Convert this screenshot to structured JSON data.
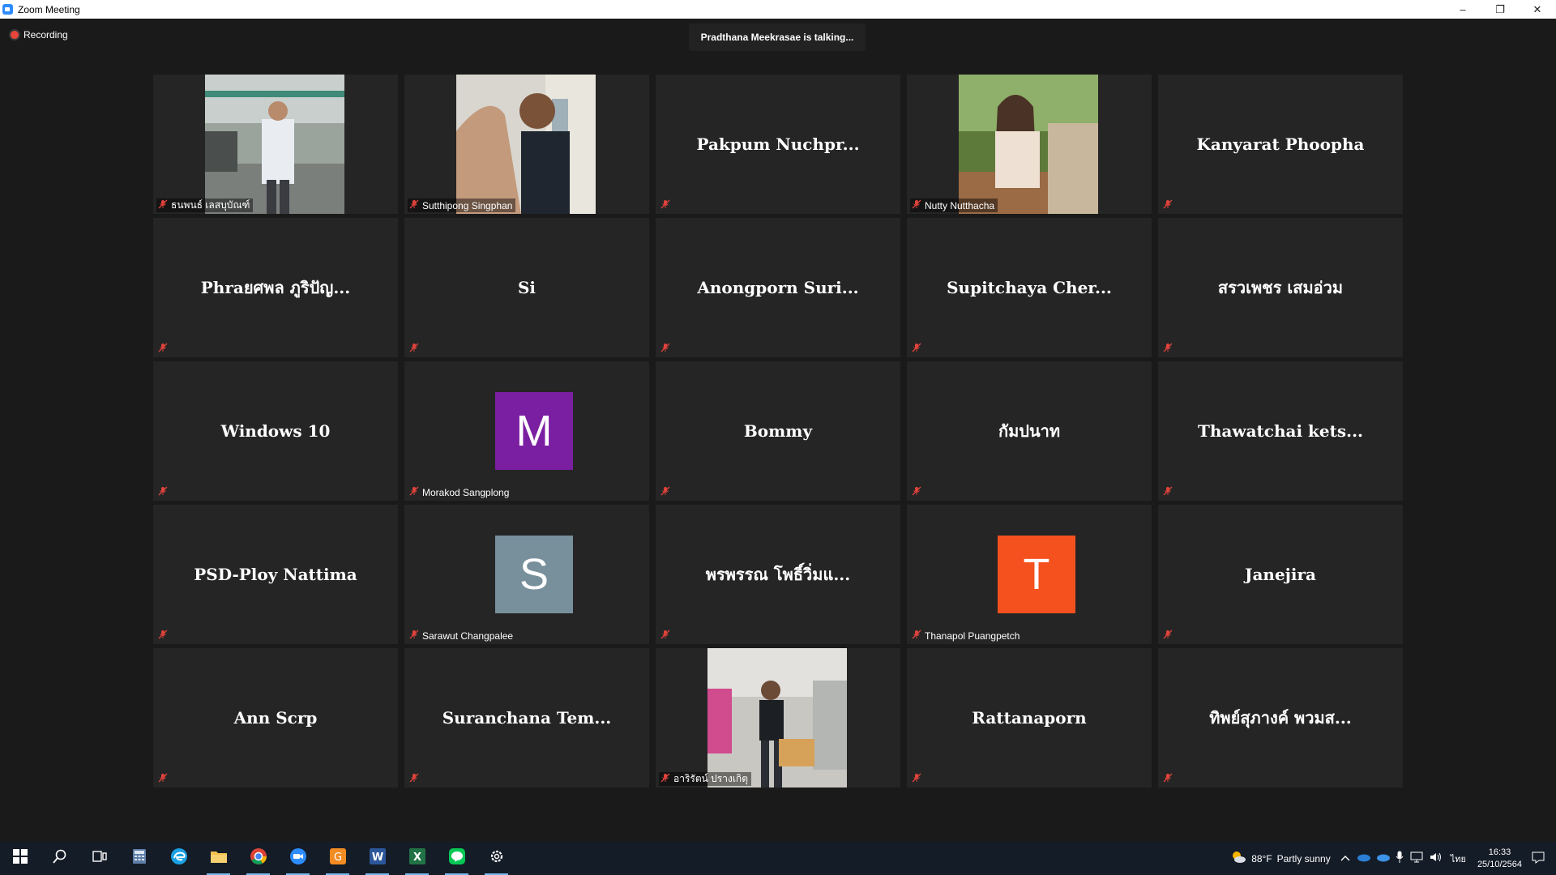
{
  "window": {
    "title": "Zoom Meeting",
    "controls": [
      "–",
      "❐",
      "✕"
    ]
  },
  "meeting": {
    "recording_label": "Recording",
    "talking_text": "Pradthana Meekrasae is talking...",
    "participants": [
      {
        "name": "ธนพนธ์ เลสบุบัณฑ์",
        "display": "video",
        "scene": "man-courtyard",
        "muted": true
      },
      {
        "name": "Sutthipong Singphan",
        "display": "video",
        "scene": "hand-wave",
        "muted": true
      },
      {
        "name": "Pakpum  Nuchpr...",
        "display": "name",
        "muted": true
      },
      {
        "name": "Nutty Nutthacha",
        "display": "video",
        "scene": "woman-garden",
        "muted": true
      },
      {
        "name": "Kanyarat Phoopha",
        "display": "name",
        "muted": true
      },
      {
        "name": "Phraยศพล ภูริปัญ...",
        "display": "name",
        "muted": true
      },
      {
        "name": "Si",
        "display": "name",
        "muted": true
      },
      {
        "name": "Anongporn  Suri...",
        "display": "name",
        "muted": true
      },
      {
        "name": "Supitchaya  Cher...",
        "display": "name",
        "muted": true
      },
      {
        "name": "สรวเพชร เสมอ่วม",
        "display": "name",
        "muted": true
      },
      {
        "name": "Windows 10",
        "display": "name",
        "muted": true
      },
      {
        "name": "Morakod Sangplong",
        "display": "avatar",
        "initial": "M",
        "color": "#7b1fa2",
        "muted": true
      },
      {
        "name": "Bommy",
        "display": "name",
        "muted": true
      },
      {
        "name": "กัมปนาท",
        "display": "name",
        "muted": true
      },
      {
        "name": "Thawatchai  kets...",
        "display": "name",
        "muted": true
      },
      {
        "name": "PSD-Ploy Nattima",
        "display": "name",
        "muted": true
      },
      {
        "name": "Sarawut Changpalee",
        "display": "avatar",
        "initial": "S",
        "color": "#78909c",
        "muted": true
      },
      {
        "name": "พรพรรณ  โพธิ์วิ่มแ...",
        "display": "name",
        "muted": true
      },
      {
        "name": "Thanapol Puangpetch",
        "display": "avatar",
        "initial": "T",
        "color": "#f4511e",
        "muted": true
      },
      {
        "name": "Janejira",
        "display": "name",
        "muted": true
      },
      {
        "name": "Ann Scrp",
        "display": "name",
        "muted": true
      },
      {
        "name": "Suranchana  Tem...",
        "display": "name",
        "muted": true
      },
      {
        "name": "อาริรัตน์ ปรางเกิตุ",
        "display": "video",
        "scene": "office-box",
        "muted": true
      },
      {
        "name": "Rattanaporn",
        "display": "name",
        "muted": true
      },
      {
        "name": "ทิพย์สุภางค์  พวมส...",
        "display": "name",
        "muted": true
      }
    ]
  },
  "taskbar": {
    "apps": [
      {
        "name": "start",
        "icon": "windows-logo-icon",
        "active": false
      },
      {
        "name": "search",
        "icon": "search-icon",
        "active": false
      },
      {
        "name": "task-view",
        "icon": "task-view-icon",
        "active": false
      },
      {
        "name": "calculator",
        "icon": "calculator-icon",
        "active": false
      },
      {
        "name": "edge",
        "icon": "edge-icon",
        "active": false
      },
      {
        "name": "file-explorer",
        "icon": "folder-icon",
        "active": true
      },
      {
        "name": "chrome",
        "icon": "chrome-icon",
        "active": true
      },
      {
        "name": "zoom",
        "icon": "zoom-icon",
        "active": true
      },
      {
        "name": "slides",
        "icon": "slides-icon",
        "active": true
      },
      {
        "name": "word",
        "icon": "word-icon",
        "active": true
      },
      {
        "name": "excel",
        "icon": "excel-icon",
        "active": true
      },
      {
        "name": "line",
        "icon": "line-icon",
        "active": true
      },
      {
        "name": "settings",
        "icon": "gear-icon",
        "active": true
      }
    ],
    "weather": {
      "temp": "88°F",
      "condition": "Partly sunny"
    },
    "language": "ไทย",
    "time": "16:33",
    "date": "25/10/2564"
  }
}
